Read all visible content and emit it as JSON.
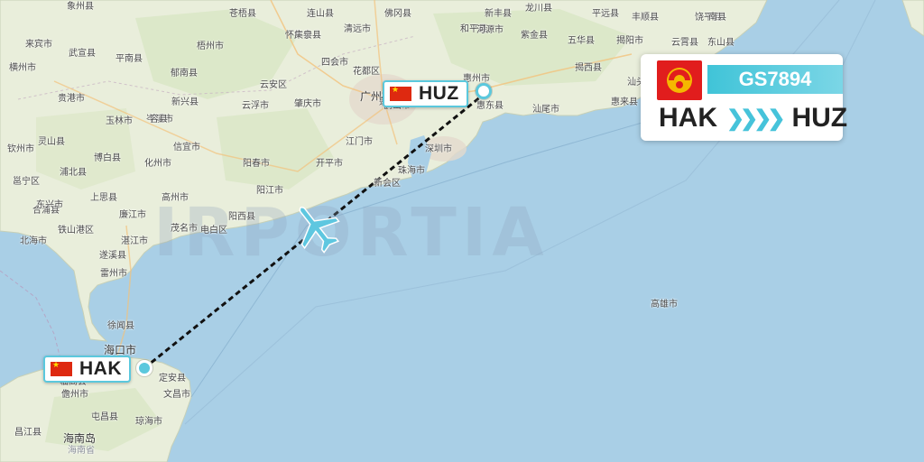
{
  "flight": {
    "number": "GS7894",
    "origin_code": "HAK",
    "destination_code": "HUZ",
    "route_arrow": "❯❯❯❯",
    "airline_logo": "airline-logo-icon",
    "flag": "china-flag-icon"
  },
  "watermark": "IRPORTIA",
  "colors": {
    "accent": "#5bc8dd",
    "sea": "#a9cfe6",
    "land": "#e9eedb",
    "flight_path": "#111111",
    "flag_red": "#de2910"
  },
  "places": [
    {
      "name": "象州县",
      "class": ""
    },
    {
      "name": "苍梧县",
      "class": ""
    },
    {
      "name": "连山县",
      "class": ""
    },
    {
      "name": "怀集县",
      "class": ""
    },
    {
      "name": "佛冈县",
      "class": ""
    },
    {
      "name": "新丰县",
      "class": ""
    },
    {
      "name": "平远县",
      "class": ""
    },
    {
      "name": "和平县",
      "class": ""
    },
    {
      "name": "龙川县",
      "class": ""
    },
    {
      "name": "来宾市",
      "class": ""
    },
    {
      "name": "武宣县",
      "class": ""
    },
    {
      "name": "梧州市",
      "class": ""
    },
    {
      "name": "广宁县",
      "class": ""
    },
    {
      "name": "清远市",
      "class": ""
    },
    {
      "name": "河源市",
      "class": ""
    },
    {
      "name": "紫金县",
      "class": ""
    },
    {
      "name": "五华县",
      "class": ""
    },
    {
      "name": "丰顺县",
      "class": ""
    },
    {
      "name": "平南县",
      "class": ""
    },
    {
      "name": "四会市",
      "class": ""
    },
    {
      "name": "花都区",
      "class": ""
    },
    {
      "name": "揭阳市",
      "class": ""
    },
    {
      "name": "饶平县",
      "class": ""
    },
    {
      "name": "贵港市",
      "class": ""
    },
    {
      "name": "郁南县",
      "class": ""
    },
    {
      "name": "云安区",
      "class": ""
    },
    {
      "name": "广州市",
      "class": "big"
    },
    {
      "name": "惠州市",
      "class": ""
    },
    {
      "name": "揭西县",
      "class": ""
    },
    {
      "name": "汕头市",
      "class": ""
    },
    {
      "name": "玉林市",
      "class": ""
    },
    {
      "name": "岑溪市",
      "class": ""
    },
    {
      "name": "云浮市",
      "class": ""
    },
    {
      "name": "肇庆市",
      "class": ""
    },
    {
      "name": "鹤山市",
      "class": ""
    },
    {
      "name": "惠东县",
      "class": ""
    },
    {
      "name": "汕尾市",
      "class": ""
    },
    {
      "name": "惠来县",
      "class": ""
    },
    {
      "name": "容县",
      "class": ""
    },
    {
      "name": "新兴县",
      "class": ""
    },
    {
      "name": "东莞市",
      "class": ""
    },
    {
      "name": "灵山县",
      "class": ""
    },
    {
      "name": "信宜市",
      "class": ""
    },
    {
      "name": "江门市",
      "class": ""
    },
    {
      "name": "深圳市",
      "class": ""
    },
    {
      "name": "博白县",
      "class": ""
    },
    {
      "name": "开平市",
      "class": ""
    },
    {
      "name": "阳春市",
      "class": ""
    },
    {
      "name": "珠海市",
      "class": ""
    },
    {
      "name": "浦北县",
      "class": ""
    },
    {
      "name": "化州市",
      "class": ""
    },
    {
      "name": "阳江市",
      "class": ""
    },
    {
      "name": "合浦县",
      "class": ""
    },
    {
      "name": "廉江市",
      "class": ""
    },
    {
      "name": "高州市",
      "class": ""
    },
    {
      "name": "阳西县",
      "class": ""
    },
    {
      "name": "北海市",
      "class": ""
    },
    {
      "name": "湛江市",
      "class": ""
    },
    {
      "name": "茂名市",
      "class": ""
    },
    {
      "name": "电白区",
      "class": ""
    },
    {
      "name": "遂溪县",
      "class": ""
    },
    {
      "name": "铁山港区",
      "class": ""
    },
    {
      "name": "雷州市",
      "class": ""
    },
    {
      "name": "徐闻县",
      "class": ""
    },
    {
      "name": "海口市",
      "class": "big"
    },
    {
      "name": "澄迈县",
      "class": ""
    },
    {
      "name": "临高县",
      "class": ""
    },
    {
      "name": "儋州市",
      "class": ""
    },
    {
      "name": "屯昌县",
      "class": ""
    },
    {
      "name": "文昌市",
      "class": ""
    },
    {
      "name": "琼海市",
      "class": ""
    },
    {
      "name": "昌江县",
      "class": ""
    },
    {
      "name": "海南岛",
      "class": "big"
    },
    {
      "name": "海南省",
      "class": "muted"
    },
    {
      "name": "高雄市",
      "class": ""
    },
    {
      "name": "东山县",
      "class": ""
    },
    {
      "name": "云霄县",
      "class": ""
    },
    {
      "name": "南县",
      "class": ""
    },
    {
      "name": "横州市",
      "class": ""
    },
    {
      "name": "钦州市",
      "class": ""
    },
    {
      "name": "邕宁区",
      "class": ""
    },
    {
      "name": "上思县",
      "class": ""
    },
    {
      "name": "东兴市",
      "class": ""
    },
    {
      "name": "新会区",
      "class": ""
    },
    {
      "name": "蓬江区",
      "class": ""
    },
    {
      "name": "定安县",
      "class": ""
    },
    {
      "name": "澄海区",
      "class": ""
    }
  ]
}
